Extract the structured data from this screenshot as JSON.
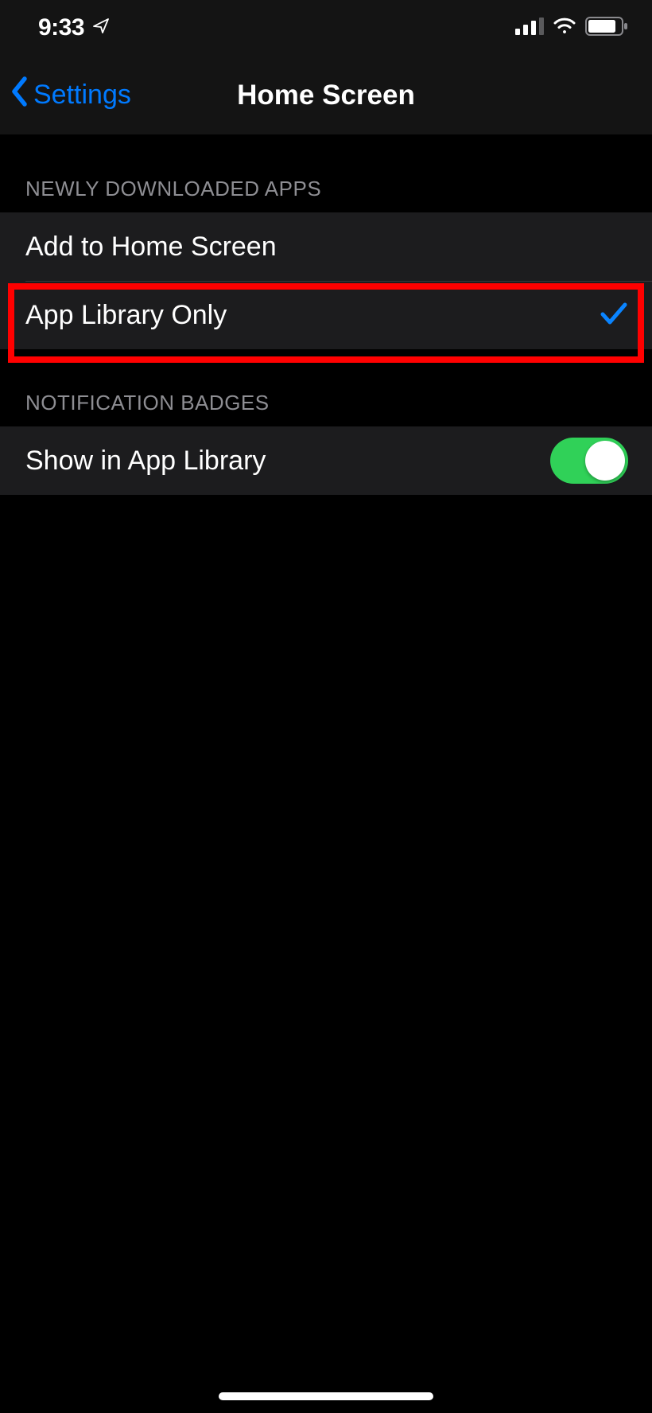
{
  "status": {
    "time": "9:33"
  },
  "nav": {
    "back_label": "Settings",
    "title": "Home Screen"
  },
  "sections": {
    "downloaded": {
      "header": "NEWLY DOWNLOADED APPS",
      "options": [
        {
          "label": "Add to Home Screen",
          "selected": false
        },
        {
          "label": "App Library Only",
          "selected": true
        }
      ]
    },
    "badges": {
      "header": "NOTIFICATION BADGES",
      "row_label": "Show in App Library",
      "toggle_on": true
    }
  },
  "colors": {
    "accent": "#007aff",
    "toggle_on": "#30d158",
    "highlight": "#ff0000"
  }
}
